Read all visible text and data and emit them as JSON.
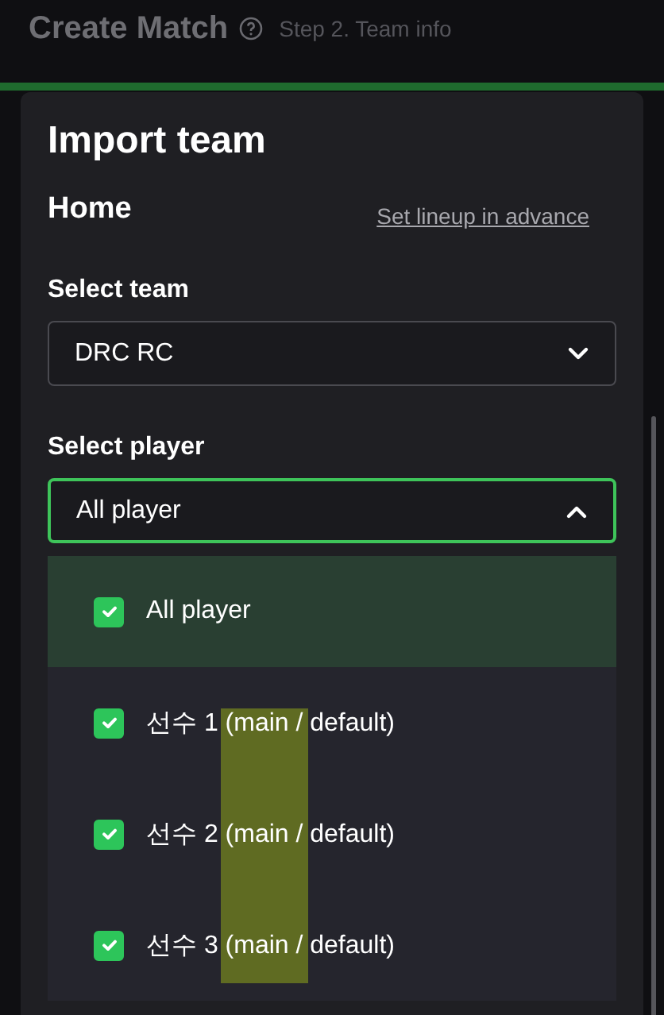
{
  "header": {
    "title": "Create Match",
    "step": "Step 2. Team info"
  },
  "panel": {
    "title": "Import team",
    "section": "Home",
    "link": "Set lineup in advance"
  },
  "team_select": {
    "label": "Select team",
    "value": "DRC RC",
    "expanded": false
  },
  "player_select": {
    "label": "Select player",
    "value": "All player",
    "expanded": true
  },
  "options": [
    {
      "label": "All player",
      "checked": true,
      "selected": true
    },
    {
      "label": "선수 1 (main / default)",
      "checked": true,
      "selected": false
    },
    {
      "label": "선수 2 (main / default)",
      "checked": true,
      "selected": false
    },
    {
      "label": "선수 3 (main / default)",
      "checked": true,
      "selected": false
    }
  ]
}
